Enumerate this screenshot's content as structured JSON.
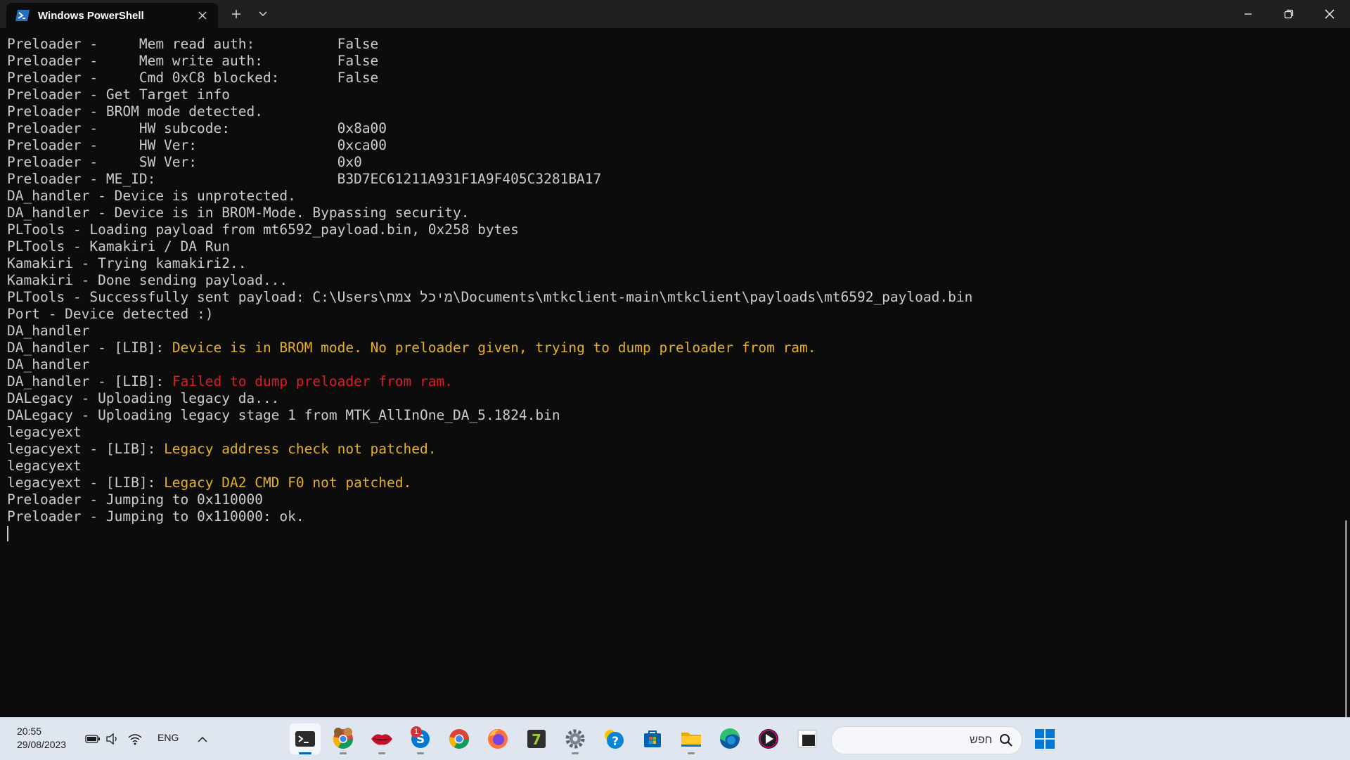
{
  "window": {
    "tab_title": "Windows PowerShell",
    "new_tab_label": "+",
    "controls": [
      "minimize",
      "restore",
      "close"
    ]
  },
  "terminal": {
    "lines": [
      [
        {
          "t": "Preloader -     Mem read auth:          False"
        }
      ],
      [
        {
          "t": "Preloader -     Mem write auth:         False"
        }
      ],
      [
        {
          "t": "Preloader -     Cmd 0xC8 blocked:       False"
        }
      ],
      [
        {
          "t": "Preloader - Get Target info"
        }
      ],
      [
        {
          "t": "Preloader - BROM mode detected."
        }
      ],
      [
        {
          "t": "Preloader -     HW subcode:             0x8a00"
        }
      ],
      [
        {
          "t": "Preloader -     HW Ver:                 0xca00"
        }
      ],
      [
        {
          "t": "Preloader -     SW Ver:                 0x0"
        }
      ],
      [
        {
          "t": "Preloader - ME_ID:                      B3D7EC61211A931F1A9F405C3281BA17"
        }
      ],
      [
        {
          "t": "DA_handler - Device is unprotected."
        }
      ],
      [
        {
          "t": "DA_handler - Device is in BROM-Mode. Bypassing security."
        }
      ],
      [
        {
          "t": "PLTools - Loading payload from mt6592_payload.bin, 0x258 bytes"
        }
      ],
      [
        {
          "t": "PLTools - Kamakiri / DA Run"
        }
      ],
      [
        {
          "t": "Kamakiri - Trying kamakiri2.."
        }
      ],
      [
        {
          "t": "Kamakiri - Done sending payload..."
        }
      ],
      [
        {
          "t": "PLTools - Successfully sent payload: C:\\Users\\מיכל צמח\\Documents\\mtkclient-main\\mtkclient\\payloads\\mt6592_payload.bin"
        }
      ],
      [
        {
          "t": "Port - Device detected :)"
        }
      ],
      [
        {
          "t": "DA_handler"
        }
      ],
      [
        {
          "t": "DA_handler - [LIB]: "
        },
        {
          "t": "Device is in BROM mode. No preloader given, trying to dump preloader from ram.",
          "c": "warn"
        }
      ],
      [
        {
          "t": "DA_handler"
        }
      ],
      [
        {
          "t": "DA_handler - [LIB]: "
        },
        {
          "t": "Failed to dump preloader from ram.",
          "c": "err"
        }
      ],
      [
        {
          "t": "DALegacy - Uploading legacy da..."
        }
      ],
      [
        {
          "t": "DALegacy - Uploading legacy stage 1 from MTK_AllInOne_DA_5.1824.bin"
        }
      ],
      [
        {
          "t": "legacyext"
        }
      ],
      [
        {
          "t": "legacyext - [LIB]: "
        },
        {
          "t": "Legacy address check not patched.",
          "c": "warn"
        }
      ],
      [
        {
          "t": "legacyext"
        }
      ],
      [
        {
          "t": "legacyext - [LIB]: "
        },
        {
          "t": "Legacy DA2 CMD F0 not patched.",
          "c": "warn"
        }
      ],
      [
        {
          "t": "Preloader - Jumping to 0x110000"
        }
      ],
      [
        {
          "t": "Preloader - Jumping to 0x110000: ok."
        }
      ]
    ],
    "colors": {
      "background": "#0c0c0c",
      "text": "#cccccc",
      "warning": "#e5b023",
      "error": "#e01b24"
    }
  },
  "taskbar": {
    "time": "20:55",
    "date": "29/08/2023",
    "language": "ENG",
    "search_placeholder": "חפש",
    "skype_badge": "1",
    "apps": [
      "terminal-icon",
      "chrome-profile-icon",
      "lips-app-icon",
      "skype-icon",
      "chrome-icon",
      "firefox-icon",
      "7zip-icon",
      "settings-icon",
      "help-icon",
      "store-icon",
      "file-explorer-icon",
      "edge-icon",
      "media-player-icon",
      "window-app-icon"
    ],
    "tray": [
      "battery-icon",
      "volume-icon",
      "wifi-icon",
      "chevron-up-icon"
    ]
  }
}
